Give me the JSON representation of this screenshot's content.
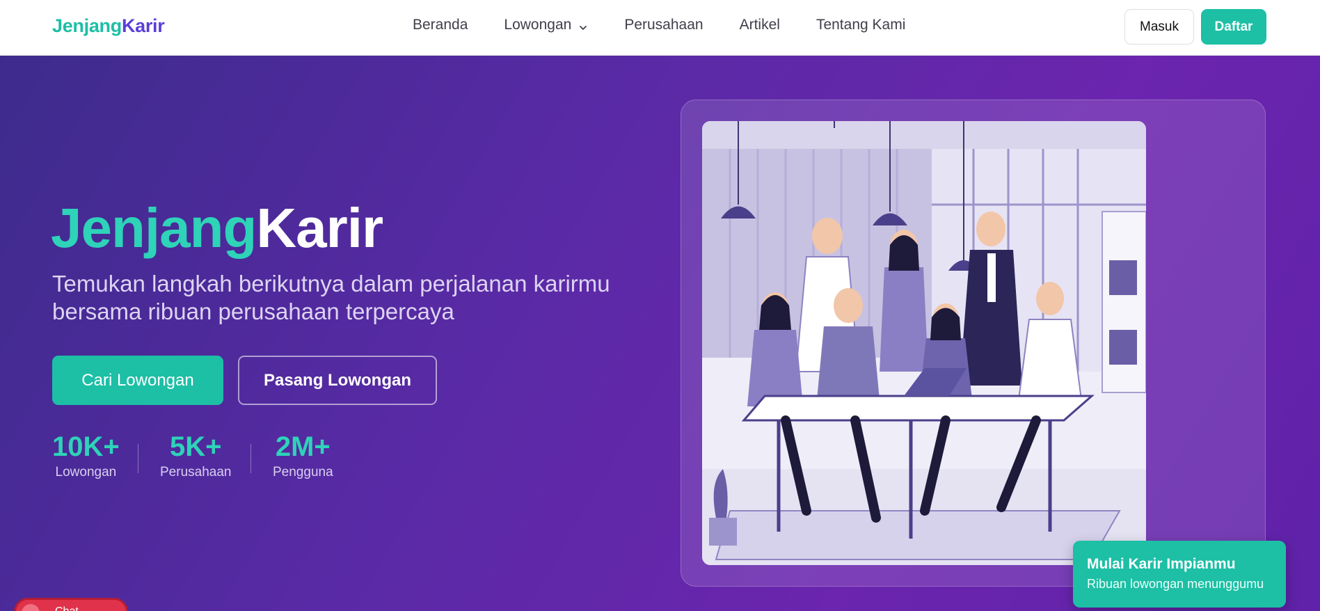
{
  "navbar": {
    "logo_part1": "Jenjang",
    "logo_part2": "Karir",
    "links": [
      {
        "label": "Beranda"
      },
      {
        "label": "Lowongan"
      },
      {
        "label": "Perusahaan"
      },
      {
        "label": "Artikel"
      },
      {
        "label": "Tentang Kami"
      }
    ],
    "login_label": "Masuk",
    "register_label": "Daftar"
  },
  "hero": {
    "title_part1": "Jenjang",
    "title_part2": "Karir",
    "subtitle": "Temukan langkah berikutnya dalam perjalanan karirmu bersama ribuan perusahaan terpercaya",
    "primary_cta": "Cari Lowongan",
    "secondary_cta": "Pasang Lowongan",
    "stats": [
      {
        "value": "10K+",
        "label": "Lowongan"
      },
      {
        "value": "5K+",
        "label": "Perusahaan"
      },
      {
        "value": "2M+",
        "label": "Pengguna"
      }
    ]
  },
  "promo_card": {
    "title": "Mulai Karir Impianmu",
    "subtitle": "Ribuan lowongan menunggumu"
  },
  "floating_button": {
    "label": "Chat"
  },
  "colors": {
    "accent_teal": "#1dbfa5",
    "brand_purple": "#5b3fd6",
    "hero_bg": "#5a2aa6"
  },
  "icons": {
    "dropdown": "chevron-down-icon",
    "illustration": "office-team-illustration"
  }
}
